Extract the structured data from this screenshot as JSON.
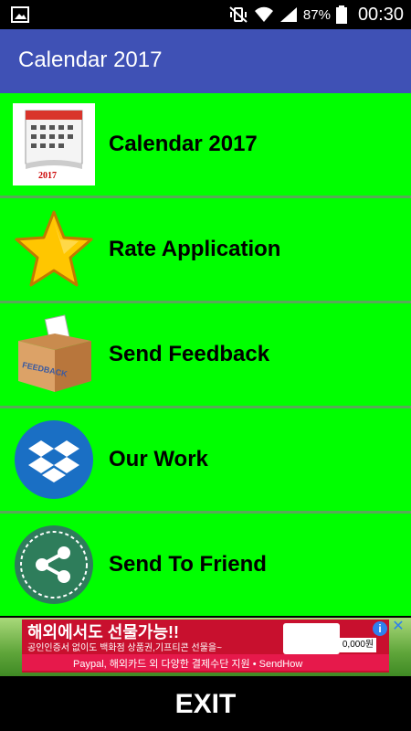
{
  "status_bar": {
    "left_icon": "image-notification-icon",
    "icons": [
      "vibrate-mute-icon",
      "wifi-icon",
      "signal-icon"
    ],
    "battery_percent": "87%",
    "battery_icon": "battery-icon",
    "time": "00:30"
  },
  "app_bar": {
    "title": "Calendar 2017",
    "color": "#3f51b5"
  },
  "menu": {
    "background": "#00ff00",
    "items": [
      {
        "label": "Calendar 2017",
        "icon": "calendar-icon"
      },
      {
        "label": "Rate Application",
        "icon": "star-icon"
      },
      {
        "label": "Send Feedback",
        "icon": "feedback-box-icon"
      },
      {
        "label": "Our Work",
        "icon": "dropbox-icon"
      },
      {
        "label": "Send To Friend",
        "icon": "share-icon"
      }
    ]
  },
  "ad": {
    "headline": "해외에서도 선물가능!!",
    "subtext": "공인인증서 없이도 백화점 상품권,기프티콘 선물을~",
    "strip": "Paypal, 해외카드 외 다양한 결제수단 지원 • SendHow",
    "price": "0,000원",
    "info_icon": "adchoices-info-icon",
    "close_icon": "ad-close-icon"
  },
  "exit_button": {
    "label": "EXIT"
  }
}
